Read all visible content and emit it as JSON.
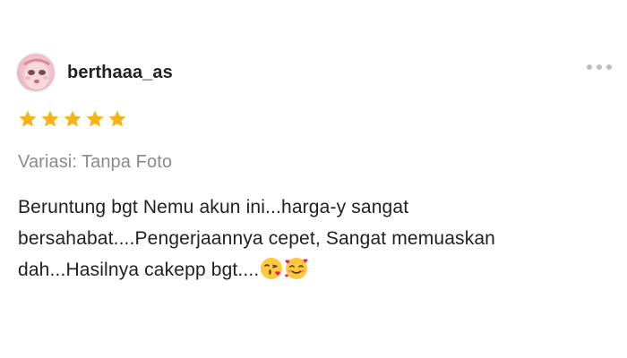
{
  "review": {
    "username": "berthaaa_as",
    "rating": 5,
    "rating_max": 5,
    "variation_label": "Variasi:",
    "variation_value": "Tanpa Foto",
    "text_lines": [
      "Beruntung bgt Nemu akun ini...harga-y sangat",
      "bersahabat....Pengerjaannya cepet, Sangat memuaskan",
      "dah...Hasilnya cakepp bgt...."
    ],
    "emojis": [
      "face-blowing-a-kiss",
      "smiling-face-with-hearts"
    ]
  },
  "icons": {
    "avatar": "avatar-photo",
    "more": "more-horizontal-icon",
    "star": "star-icon"
  },
  "colors": {
    "star": "#F7B21C",
    "username": "#222222",
    "variation": "#8A8A8A",
    "body_text": "#212121",
    "more_dots": "#BDBDBD"
  }
}
